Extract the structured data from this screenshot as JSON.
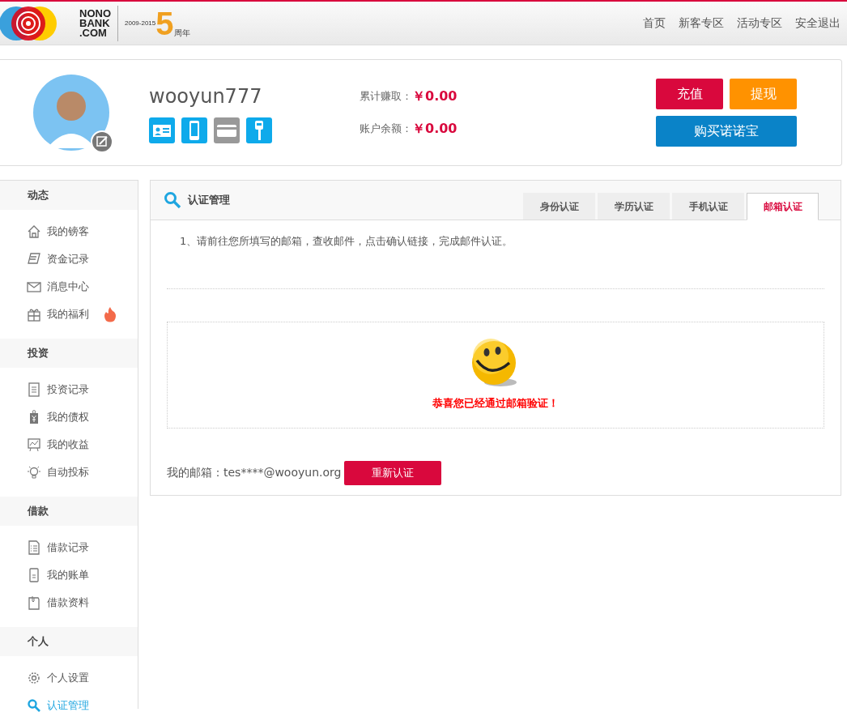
{
  "header": {
    "logo": {
      "brand_lines": [
        "NONO",
        "BANK",
        ".COM"
      ],
      "years": "2009-2015",
      "anniversary_digit": "5",
      "anniversary_label": "周年"
    },
    "nav": [
      "首页",
      "新客专区",
      "活动专区",
      "安全退出"
    ]
  },
  "profile": {
    "username": "wooyun777",
    "badges": [
      {
        "kind": "id-card",
        "verified": true
      },
      {
        "kind": "phone",
        "verified": true
      },
      {
        "kind": "bank-card",
        "verified": false
      },
      {
        "kind": "key",
        "verified": true
      }
    ],
    "stats": [
      {
        "label": "累计赚取：",
        "value": "￥0.00"
      },
      {
        "label": "账户余额：",
        "value": "￥0.00"
      }
    ],
    "buttons": [
      {
        "label": "充值",
        "kind": "recharge"
      },
      {
        "label": "提现",
        "kind": "withdraw"
      },
      {
        "label": "购买诺诺宝",
        "kind": "buy"
      }
    ]
  },
  "sidebar": {
    "sections": [
      {
        "title": "动态",
        "items": [
          {
            "label": "我的镑客",
            "kind": "house",
            "selected": false,
            "hot": false
          },
          {
            "label": "资金记录",
            "kind": "scroll",
            "selected": false,
            "hot": false
          },
          {
            "label": "消息中心",
            "kind": "envelope",
            "selected": false,
            "hot": false
          },
          {
            "label": "我的福利",
            "kind": "gift",
            "selected": false,
            "hot": true
          }
        ]
      },
      {
        "title": "投资",
        "items": [
          {
            "label": "投资记录",
            "kind": "document",
            "selected": false,
            "hot": false
          },
          {
            "label": "我的债权",
            "kind": "yen-tag",
            "selected": false,
            "hot": false
          },
          {
            "label": "我的收益",
            "kind": "chart-board",
            "selected": false,
            "hot": false
          },
          {
            "label": "自动投标",
            "kind": "bulb",
            "selected": false,
            "hot": false
          }
        ]
      },
      {
        "title": "借款",
        "items": [
          {
            "label": "借款记录",
            "kind": "list",
            "selected": false,
            "hot": false
          },
          {
            "label": "我的账单",
            "kind": "bill",
            "selected": false,
            "hot": false
          },
          {
            "label": "借款资料",
            "kind": "folder",
            "selected": false,
            "hot": false
          }
        ]
      },
      {
        "title": "个人",
        "items": [
          {
            "label": "个人设置",
            "kind": "gear",
            "selected": false,
            "hot": false
          },
          {
            "label": "认证管理",
            "kind": "search",
            "selected": true,
            "hot": false
          }
        ]
      }
    ]
  },
  "panel": {
    "title": "认证管理",
    "tabs": [
      {
        "label": "身份认证",
        "selected": false
      },
      {
        "label": "学历认证",
        "selected": false
      },
      {
        "label": "手机认证",
        "selected": false
      },
      {
        "label": "邮箱认证",
        "selected": true
      }
    ],
    "instruction": "1、请前往您所填写的邮箱，查收邮件，点击确认链接，完成邮件认证。",
    "success_message": "恭喜您已经通过邮箱验证！",
    "email_label": "我的邮箱：tes****@wooyun.org",
    "reverify_button": "重新认证"
  }
}
